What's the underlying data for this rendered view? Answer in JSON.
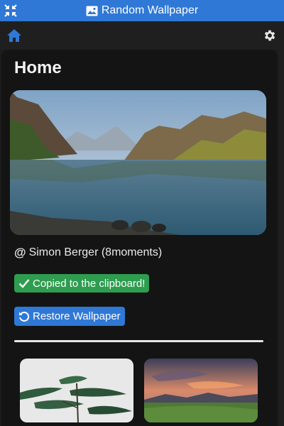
{
  "window": {
    "title": "Random Wallpaper",
    "icons": {
      "restore": "collapse-arrows-icon",
      "title": "image-icon"
    }
  },
  "toolbar": {
    "home_icon": "home-icon",
    "settings_icon": "gear-icon"
  },
  "page": {
    "title": "Home"
  },
  "current_wallpaper": {
    "author": "Simon Berger (8moments)",
    "author_icon": "at-icon"
  },
  "notification": {
    "text": "Copied to the clipboard!",
    "icon": "check-icon"
  },
  "actions": {
    "restore_label": "Restore Wallpaper",
    "restore_icon": "undo-icon"
  },
  "history": {
    "items": [
      "thumbnail-plant",
      "thumbnail-sunset-landscape"
    ]
  },
  "colors": {
    "accent": "#2f78d6",
    "success": "#2e9d4f",
    "background": "#141414"
  }
}
